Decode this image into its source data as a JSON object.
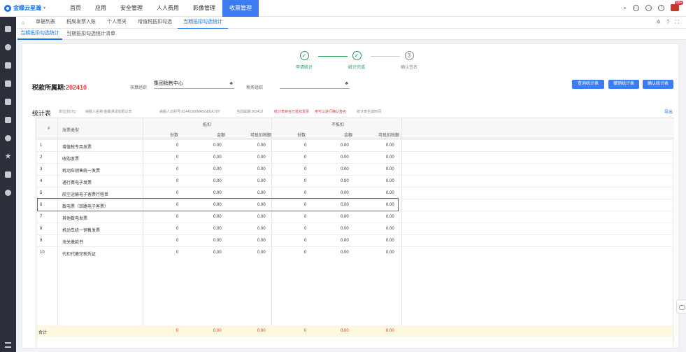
{
  "header": {
    "logo_text": "金蝶云星瀚",
    "nav": [
      "首页",
      "应用",
      "安全管理",
      "人人费用",
      "影像管理",
      "收票管理"
    ],
    "active_nav": 5,
    "badge": "99+"
  },
  "tabs": [
    "单据列表",
    "税局发票入账",
    "个人票夹",
    "增值税抵扣勾选",
    "当期抵扣勾选统计"
  ],
  "active_tab": 4,
  "subtabs": [
    "当期抵扣勾选统计",
    "当期抵扣勾选统计清单"
  ],
  "active_subtab": 0,
  "steps": [
    {
      "label": "申请统计",
      "mark": "✓",
      "done": true
    },
    {
      "label": "统计完成",
      "mark": "✓",
      "done": true
    },
    {
      "label": "确认签名",
      "mark": "3",
      "done": false
    }
  ],
  "period": {
    "label": "税款所属期:",
    "value": "202410"
  },
  "form": {
    "org_label": "核算组织",
    "org_value": "集团销售中心",
    "tax_org_label": "税务组织",
    "tax_org_value": ""
  },
  "buttons": {
    "query": "查询统计表",
    "cancel": "撤销统计表",
    "confirm": "确认统计表"
  },
  "stat": {
    "title": "统计表",
    "unit": "单位(份/元)",
    "taxpayer": "纳税人名称:金蝶测试有限公司",
    "tax_id": "纳税人识别号:91440300MA5G8GK78Y",
    "current_period": "当前属期:202410",
    "warning1": "统计表将在已抵扣发票",
    "warning2": "用可以进行确认签名",
    "time": "统计表生成时间",
    "export": "导出"
  },
  "table": {
    "head_index": "#",
    "head_type": "发票类型",
    "group_deduct": "抵扣",
    "group_nondeduct": "不抵扣",
    "sub_count": "份数",
    "sub_amount": "金额",
    "sub_tax": "可抵扣税额",
    "rows": [
      {
        "no": "1",
        "type": "增值税专用发票",
        "c1": "0",
        "a1": "0.00",
        "t1": "0.00",
        "c2": "0",
        "a2": "0.00",
        "t2": "0.00"
      },
      {
        "no": "2",
        "type": "收购发票",
        "c1": "0",
        "a1": "0.00",
        "t1": "0.00",
        "c2": "0",
        "a2": "0.00",
        "t2": "0.00"
      },
      {
        "no": "3",
        "type": "机动车销售统一发票",
        "c1": "0",
        "a1": "0.00",
        "t1": "0.00",
        "c2": "0",
        "a2": "0.00",
        "t2": "0.00"
      },
      {
        "no": "4",
        "type": "通行费电子发票",
        "c1": "0",
        "a1": "0.00",
        "t1": "0.00",
        "c2": "0",
        "a2": "0.00",
        "t2": "0.00"
      },
      {
        "no": "5",
        "type": "航空运输电子客票行程单",
        "c1": "0",
        "a1": "0.00",
        "t1": "0.00",
        "c2": "0",
        "a2": "0.00",
        "t2": "0.00"
      },
      {
        "no": "6",
        "type": "数电票（铁路电子客票）",
        "c1": "0",
        "a1": "0.00",
        "t1": "0.00",
        "c2": "0",
        "a2": "0.00",
        "t2": "0.00"
      },
      {
        "no": "7",
        "type": "其他数电发票",
        "c1": "0",
        "a1": "0.00",
        "t1": "0.00",
        "c2": "0",
        "a2": "0.00",
        "t2": "0.00"
      },
      {
        "no": "8",
        "type": "机动车统一销售发票",
        "c1": "0",
        "a1": "0.00",
        "t1": "0.00",
        "c2": "0",
        "a2": "0.00",
        "t2": "0.00"
      },
      {
        "no": "9",
        "type": "海关缴款书",
        "c1": "0",
        "a1": "0.00",
        "t1": "0.00",
        "c2": "0",
        "a2": "0.00",
        "t2": "0.00"
      },
      {
        "no": "10",
        "type": "代扣代缴完税凭证",
        "c1": "0",
        "a1": "0.00",
        "t1": "0.00",
        "c2": "0",
        "a2": "0.00",
        "t2": "0.00"
      }
    ],
    "total": {
      "label": "合计",
      "c1": "0",
      "a1": "0.00",
      "t1": "0.00",
      "c2": "0",
      "a2": "0.00",
      "t2": "0.00"
    }
  }
}
